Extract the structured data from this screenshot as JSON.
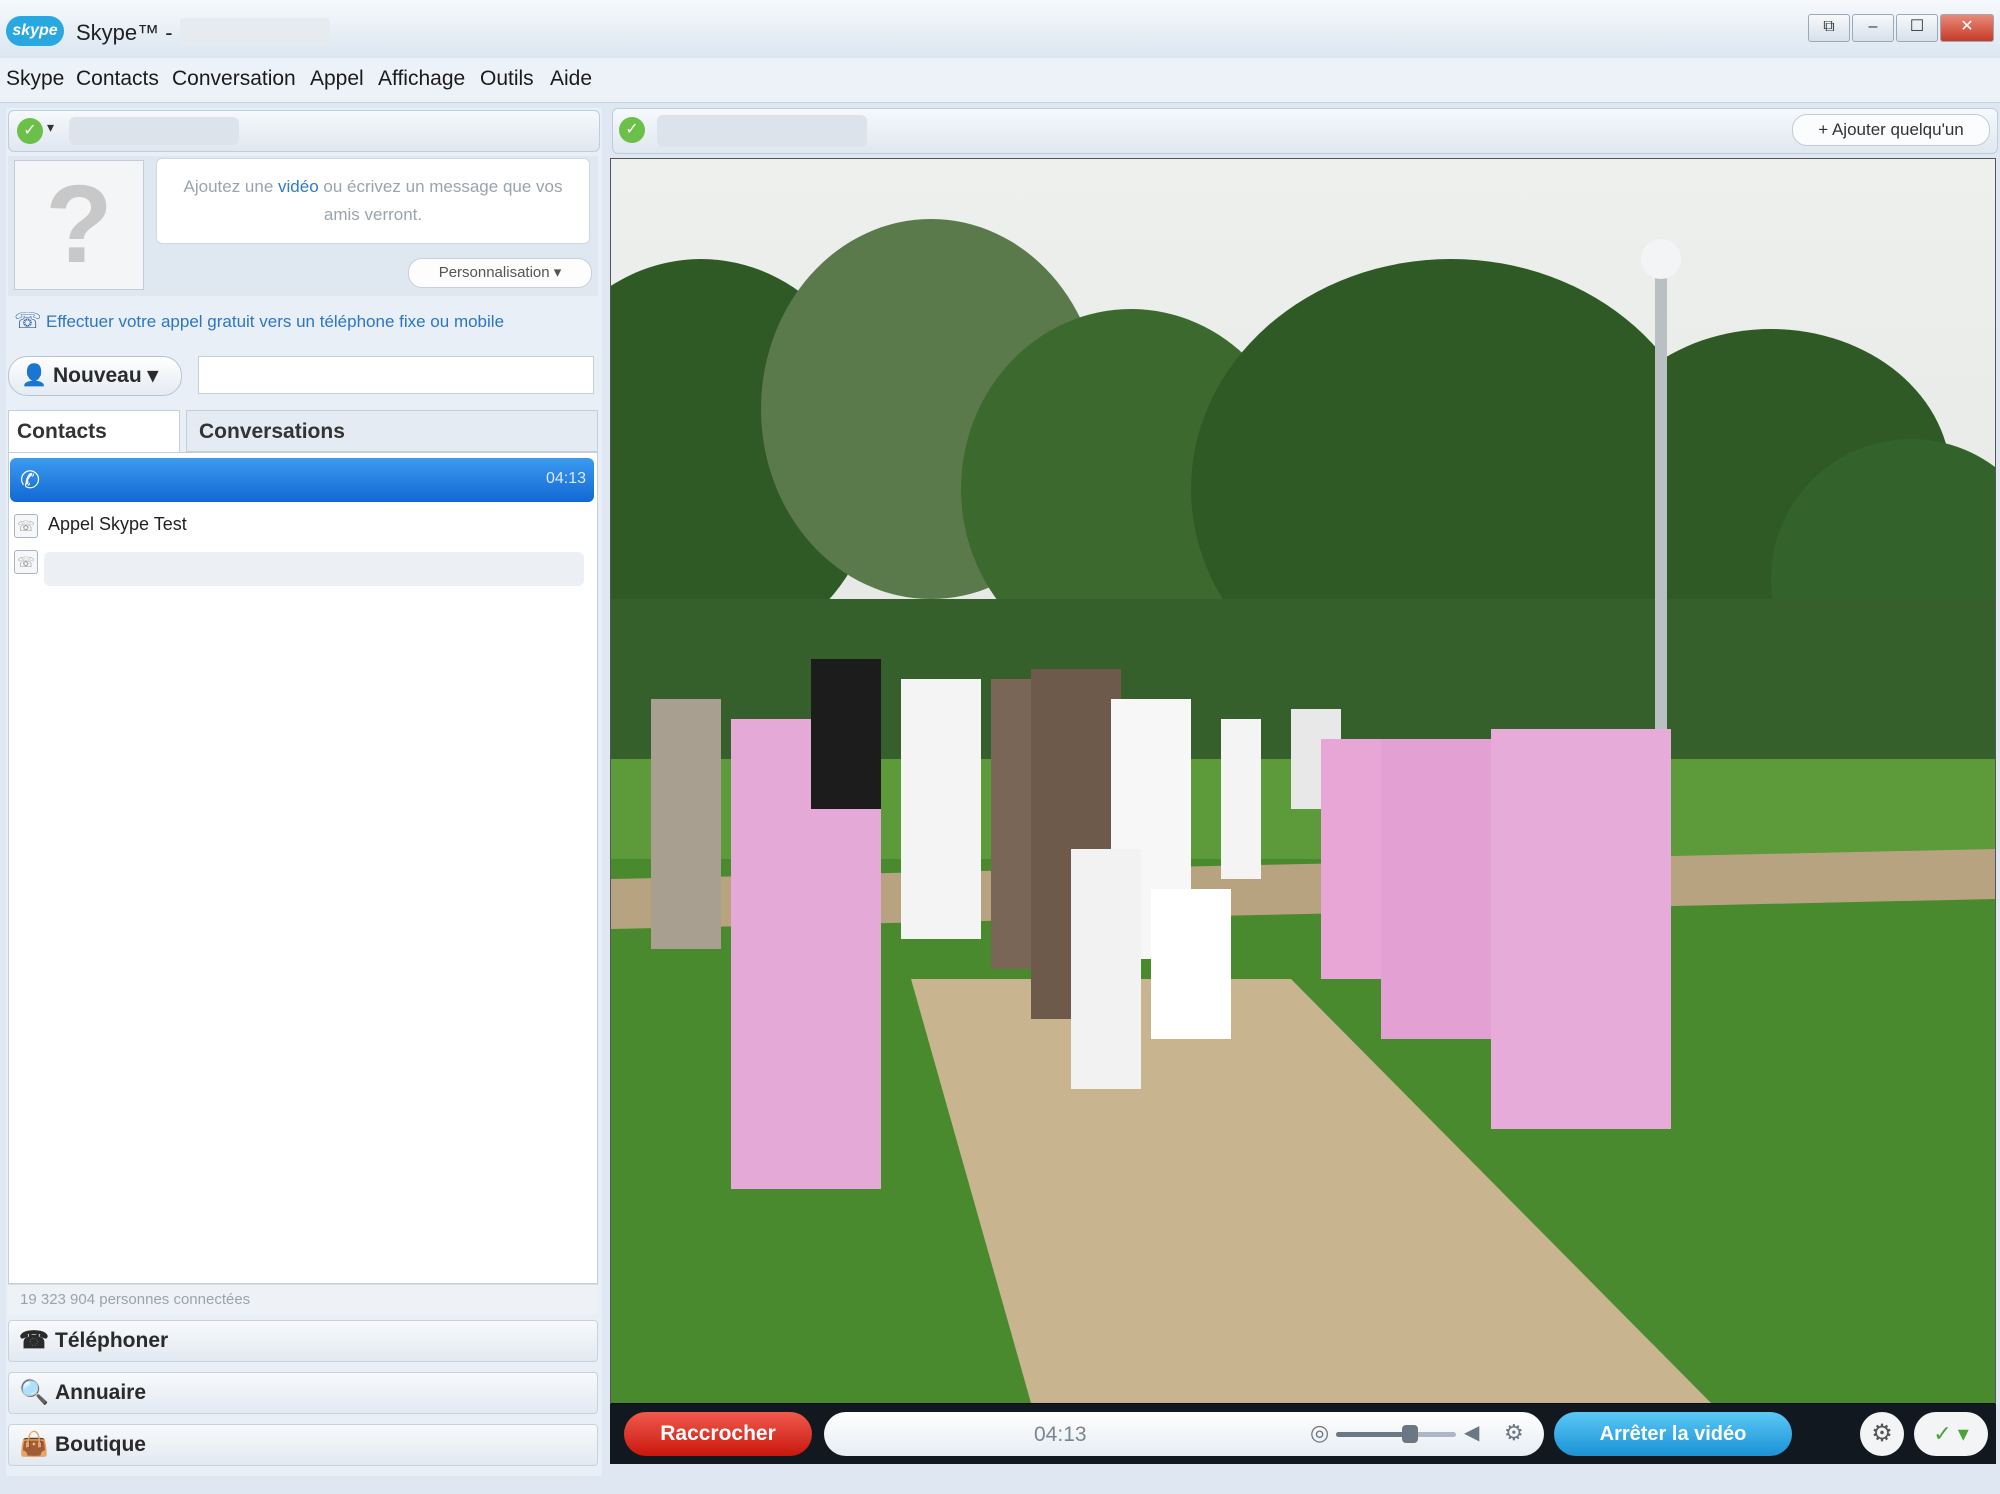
{
  "window": {
    "app_title": "Skype™ -",
    "logo_text": "skype",
    "controls": [
      "⧉",
      "–",
      "☐",
      "✕"
    ]
  },
  "menu": [
    "Skype",
    "Contacts",
    "Conversation",
    "Appel",
    "Affichage",
    "Outils",
    "Aide"
  ],
  "profile": {
    "avatar_placeholder": "?",
    "mood_pre": "Ajoutez une",
    "mood_link": "vidéo",
    "mood_post": "ou écrivez un message que vos amis verront.",
    "personalize_label": "Personnalisation ▾"
  },
  "promo": {
    "text": "Effectuer votre appel gratuit vers un téléphone fixe ou mobile"
  },
  "new_button": {
    "icon": "👤",
    "label": "Nouveau ▾"
  },
  "tabs": {
    "contacts": "Contacts",
    "conversations": "Conversations"
  },
  "contact_list": {
    "active_call_time": "04:13",
    "items": [
      {
        "label": "Appel Skype Test"
      }
    ]
  },
  "footer": {
    "online_count": "19 323 904 personnes connectées"
  },
  "nav": [
    {
      "icon": "☎",
      "label": "Téléphoner"
    },
    {
      "icon": "🔍",
      "label": "Annuaire"
    },
    {
      "icon": "👜",
      "label": "Boutique"
    }
  ],
  "conversation": {
    "add_someone": "+ Ajouter quelqu'un"
  },
  "call_controls": {
    "hangup": "Raccrocher",
    "call_time": "04:13",
    "stop_video": "Arrêter la vidéo",
    "volume_level": 0.62
  },
  "colors": {
    "accent_blue": "#1168d4",
    "hangup_red": "#c9170d",
    "video_blue": "#1b92d6",
    "online_green": "#6cc04a"
  },
  "icons": {
    "skype_status": "skype-status-icon",
    "phone": "phone-icon",
    "settings": "gear-icon",
    "mic": "microphone-icon",
    "speaker": "speaker-icon"
  }
}
